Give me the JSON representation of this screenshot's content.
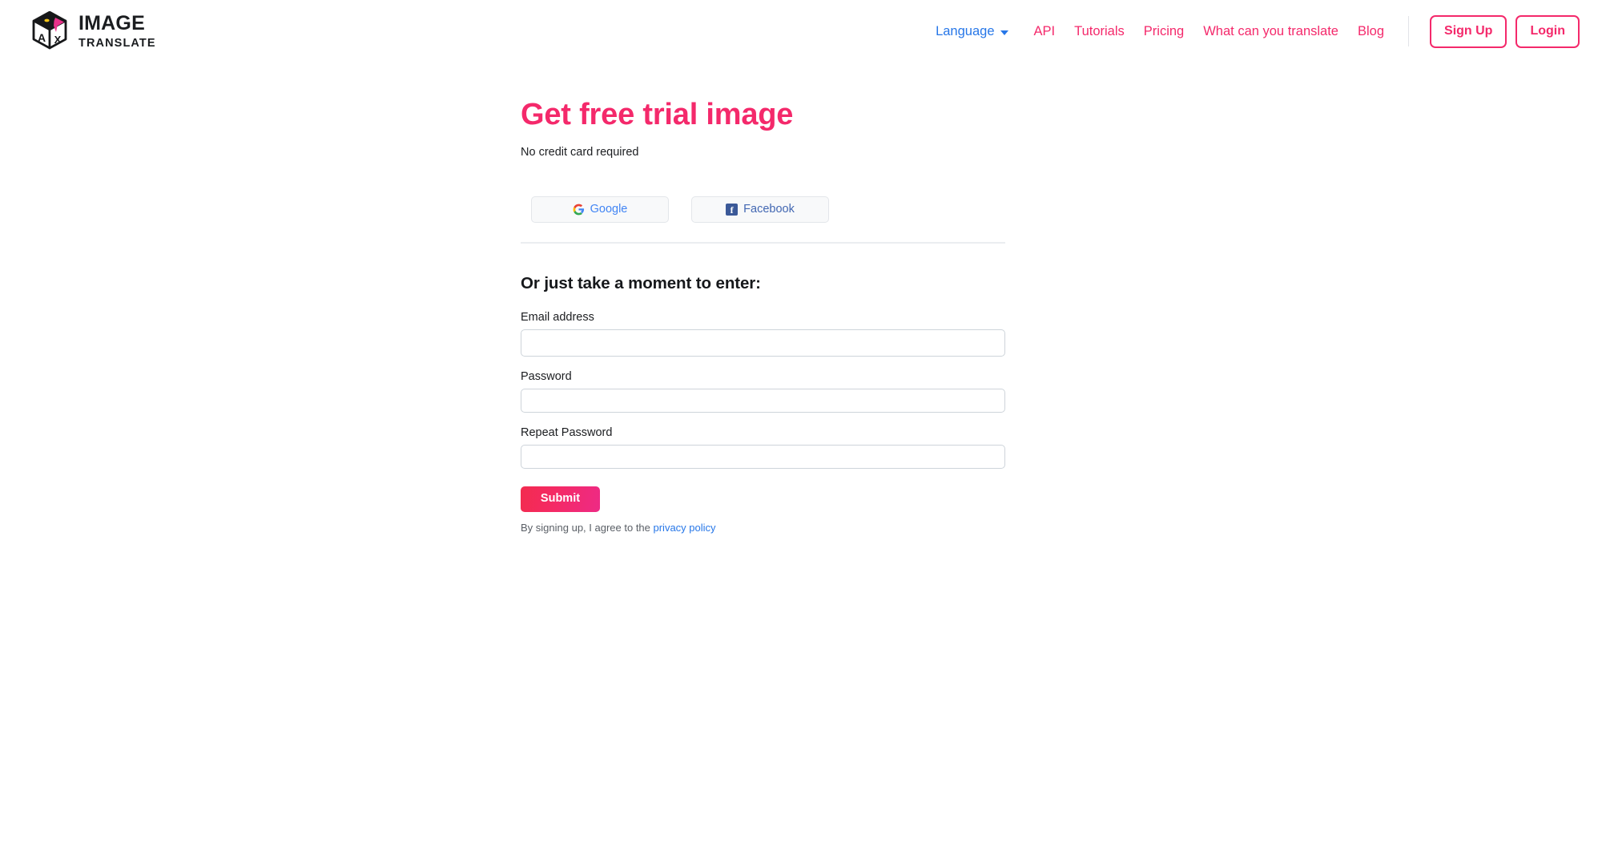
{
  "brand": {
    "title": "IMAGE",
    "subtitle": "TRANSLATE",
    "logo_icon": "cube-logo-icon",
    "colors": {
      "accent": "#f4296b",
      "link": "#2777e8"
    }
  },
  "nav": {
    "language": {
      "label": "Language",
      "icon": "chevron-down-icon"
    },
    "links": [
      {
        "label": "API"
      },
      {
        "label": "Tutorials"
      },
      {
        "label": "Pricing"
      },
      {
        "label": "What can you translate"
      },
      {
        "label": "Blog"
      }
    ],
    "buttons": [
      {
        "label": "Sign Up"
      },
      {
        "label": "Login"
      }
    ]
  },
  "main": {
    "title": "Get free trial image",
    "subtitle": "No credit card required",
    "social": [
      {
        "label": "Google",
        "icon": "google-icon"
      },
      {
        "label": "Facebook",
        "icon": "facebook-icon"
      }
    ],
    "form": {
      "heading": "Or just take a moment to enter:",
      "fields": [
        {
          "label": "Email address",
          "value": "",
          "placeholder": ""
        },
        {
          "label": "Password",
          "value": "",
          "placeholder": ""
        },
        {
          "label": "Repeat Password",
          "value": "",
          "placeholder": ""
        }
      ],
      "submit_label": "Submit",
      "legal_prefix": "By signing up, I agree to the ",
      "legal_link": "privacy policy"
    }
  }
}
